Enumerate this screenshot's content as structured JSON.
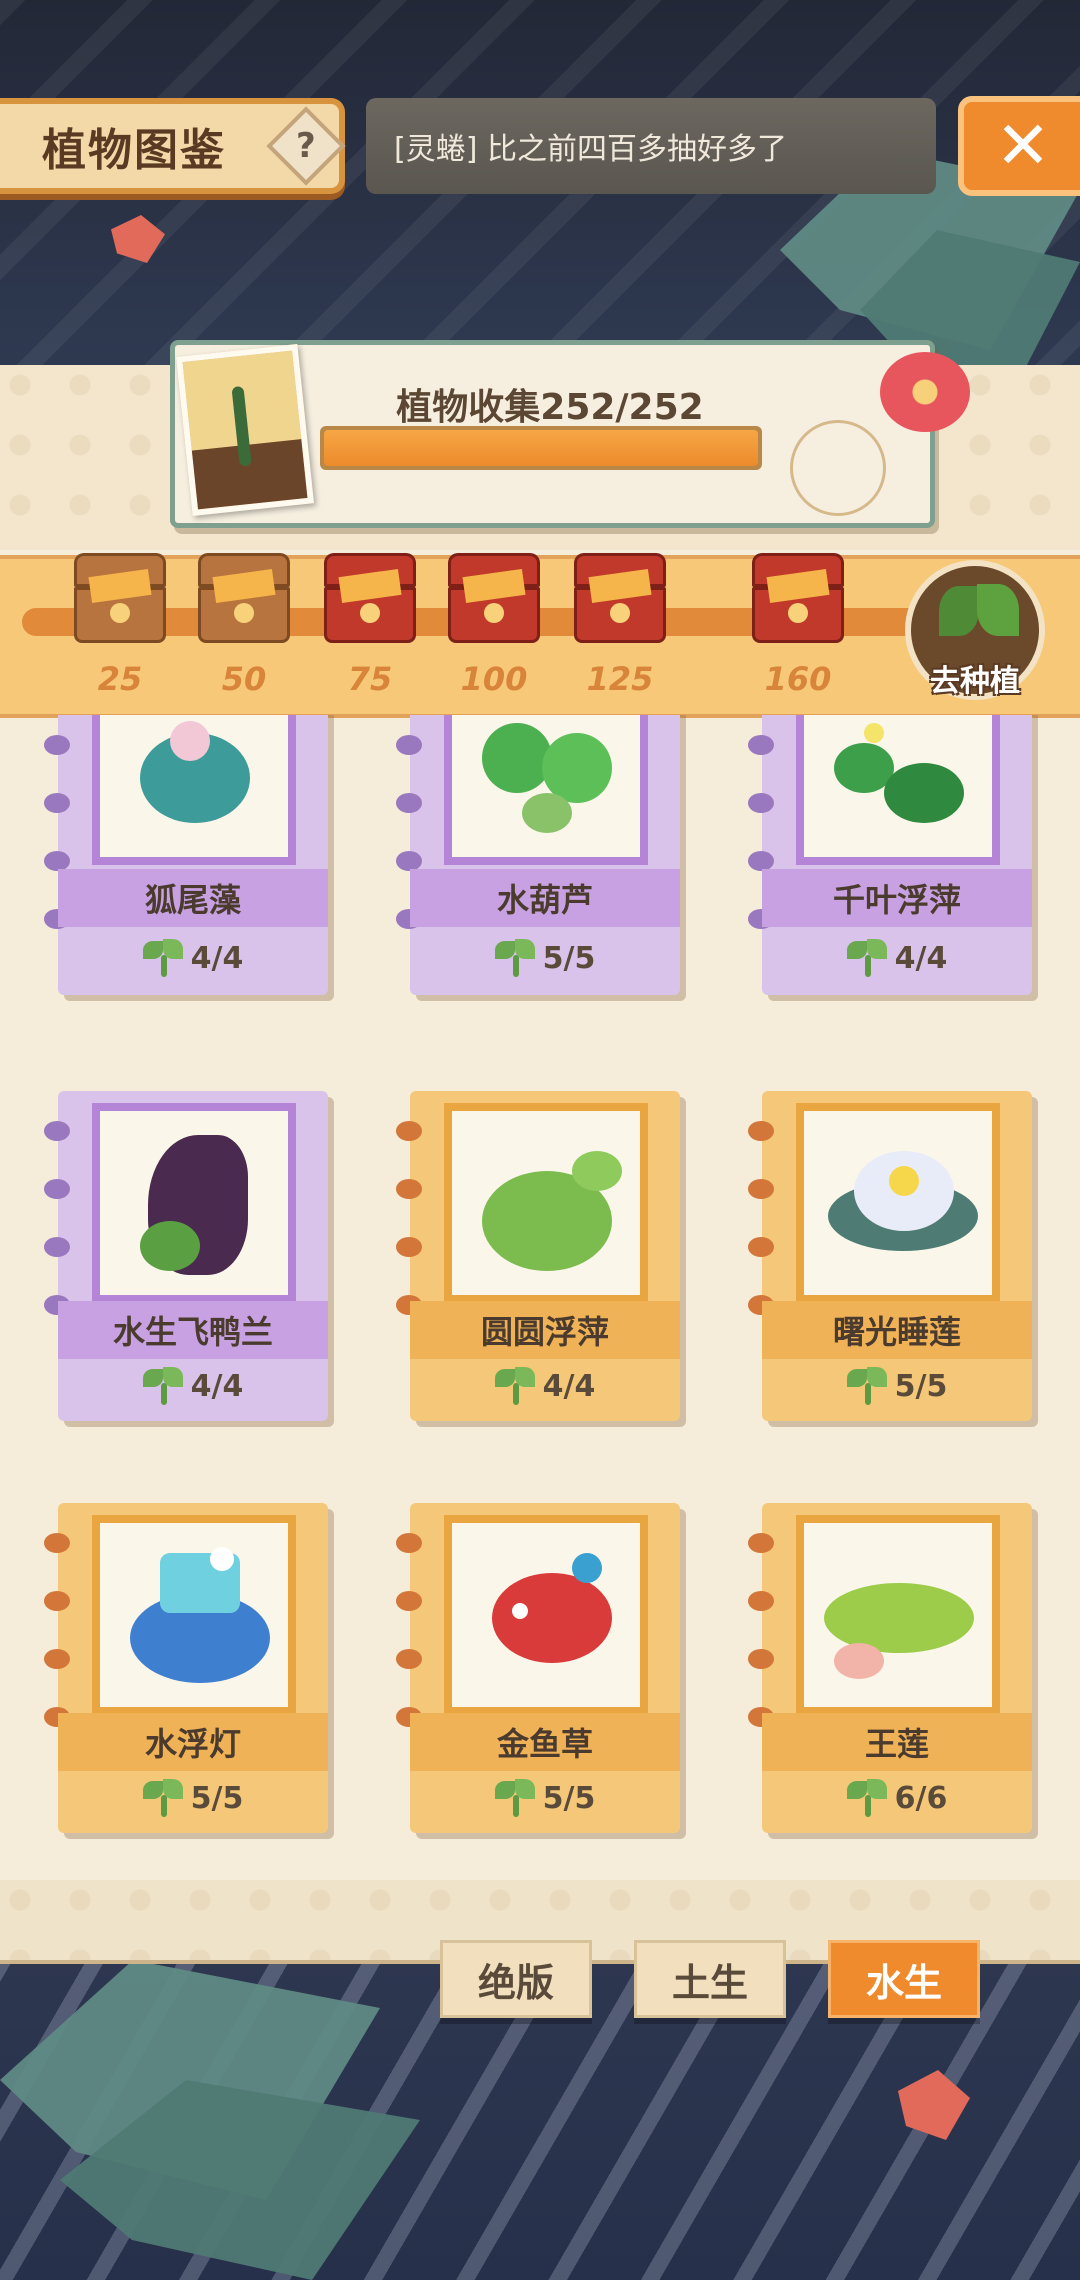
{
  "header": {
    "title": "植物图鉴",
    "help_icon": "?",
    "ticker": "[灵蜷] 比之前四百多抽好多了",
    "close_icon": "✕"
  },
  "collection": {
    "label": "植物收集252/252",
    "progress": 1.0
  },
  "rewards": {
    "milestones": [
      "25",
      "50",
      "75",
      "100",
      "125",
      "160"
    ],
    "plant_button_label": "去种植"
  },
  "cards": [
    {
      "name": "狐尾藻",
      "count": "4/4",
      "theme": "purple"
    },
    {
      "name": "水葫芦",
      "count": "5/5",
      "theme": "purple"
    },
    {
      "name": "千叶浮萍",
      "count": "4/4",
      "theme": "purple"
    },
    {
      "name": "水生飞鸭兰",
      "count": "4/4",
      "theme": "purple"
    },
    {
      "name": "圆圆浮萍",
      "count": "4/4",
      "theme": "orange"
    },
    {
      "name": "曙光睡莲",
      "count": "5/5",
      "theme": "orange"
    },
    {
      "name": "水浮灯",
      "count": "5/5",
      "theme": "orange"
    },
    {
      "name": "金鱼草",
      "count": "5/5",
      "theme": "orange"
    },
    {
      "name": "王莲",
      "count": "6/6",
      "theme": "orange"
    }
  ],
  "tabs": [
    {
      "label": "绝版",
      "active": false
    },
    {
      "label": "土生",
      "active": false
    },
    {
      "label": "水生",
      "active": true
    }
  ],
  "colors": {
    "accent": "#ef8a2d",
    "purple_card": "#d9c3ea",
    "orange_card": "#f4c878",
    "cream": "#f5ecda"
  }
}
